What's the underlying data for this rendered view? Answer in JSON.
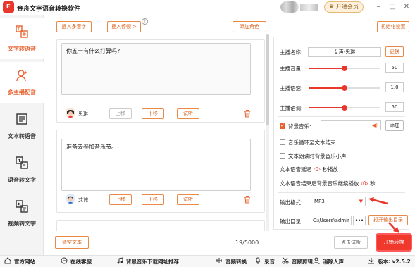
{
  "app": {
    "title": "金舟文字语音转换软件",
    "logo_glyph": "F",
    "vip_label": "开通会员"
  },
  "window": {
    "minimize": "–",
    "maximize": "□",
    "close": "✕"
  },
  "sidebar": {
    "items": [
      {
        "label": "文字转语音",
        "icon": "text-to-speech-icon",
        "active": true
      },
      {
        "label": "多主播配音",
        "icon": "multi-speaker-icon",
        "active": true
      },
      {
        "label": "文本转语音",
        "icon": "document-icon",
        "active": false
      },
      {
        "label": "语音转文字",
        "icon": "speech-to-text-icon",
        "active": false
      },
      {
        "label": "视频转文字",
        "icon": "video-to-text-icon",
        "active": false
      }
    ]
  },
  "toolbar": {
    "insert_polyphone": "插入多音字",
    "insert_pause": "插入停顿 >",
    "help": "?",
    "add_role": "添加角色",
    "init_settings": "初始化设置"
  },
  "script": {
    "rows": [
      {
        "text": "你五一有什么打算吗?",
        "speaker": "思琪",
        "up": "上移",
        "down": "下移",
        "listen": "试听",
        "up_enabled": false
      },
      {
        "text": "准备去参加音乐节。",
        "speaker": "艾诚",
        "up": "上移",
        "down": "下移",
        "listen": "试听",
        "up_enabled": true
      }
    ]
  },
  "counter": "19/5000",
  "clear_label": "清空文本",
  "settings": {
    "anchor_label": "主播名称:",
    "anchor_value": "女声-思琪",
    "change_label": "更换",
    "volume_label": "主播音量:",
    "volume_value": "50",
    "volume_fraction": 0.5,
    "speed_label": "主播语速:",
    "speed_value": "1.0",
    "speed_fraction": 0.5,
    "pitch_label": "主播语调:",
    "pitch_value": "50",
    "pitch_fraction": 0.5,
    "bgm_label": "背景音乐:",
    "bgm_checked": true,
    "bgm_add": "添加",
    "loop_label": "音乐循环至文本结束",
    "lower_label": "文本朗读时背景音乐小声",
    "delay_prefix": "文本语音延迟",
    "delay_value": "0",
    "delay_suffix": "秒播放",
    "continue_prefix": "文本语音结束后背景音乐继续播放",
    "continue_value": "0",
    "continue_suffix": "秒",
    "format_label": "输出格式:",
    "format_value": "MP3",
    "dir_label": "输出目录:",
    "dir_value": "C:\\Users\\admir",
    "dir_more": "•••",
    "open_dir": "打开输出目录"
  },
  "actions": {
    "listen": "点击试听",
    "start": "开始转换"
  },
  "bottombar": {
    "website": "官方网站",
    "service": "在线客服",
    "bgm_site": "背景音乐下载网址推荐",
    "audio_convert": "音频转换",
    "record": "录音",
    "audio_cut": "音频剪辑",
    "remove_vocal": "消除人声",
    "version": "版本: v2.5.2"
  },
  "colors": {
    "accent": "#e8602d",
    "red": "#e8372d",
    "button_border": "#e98a48"
  }
}
